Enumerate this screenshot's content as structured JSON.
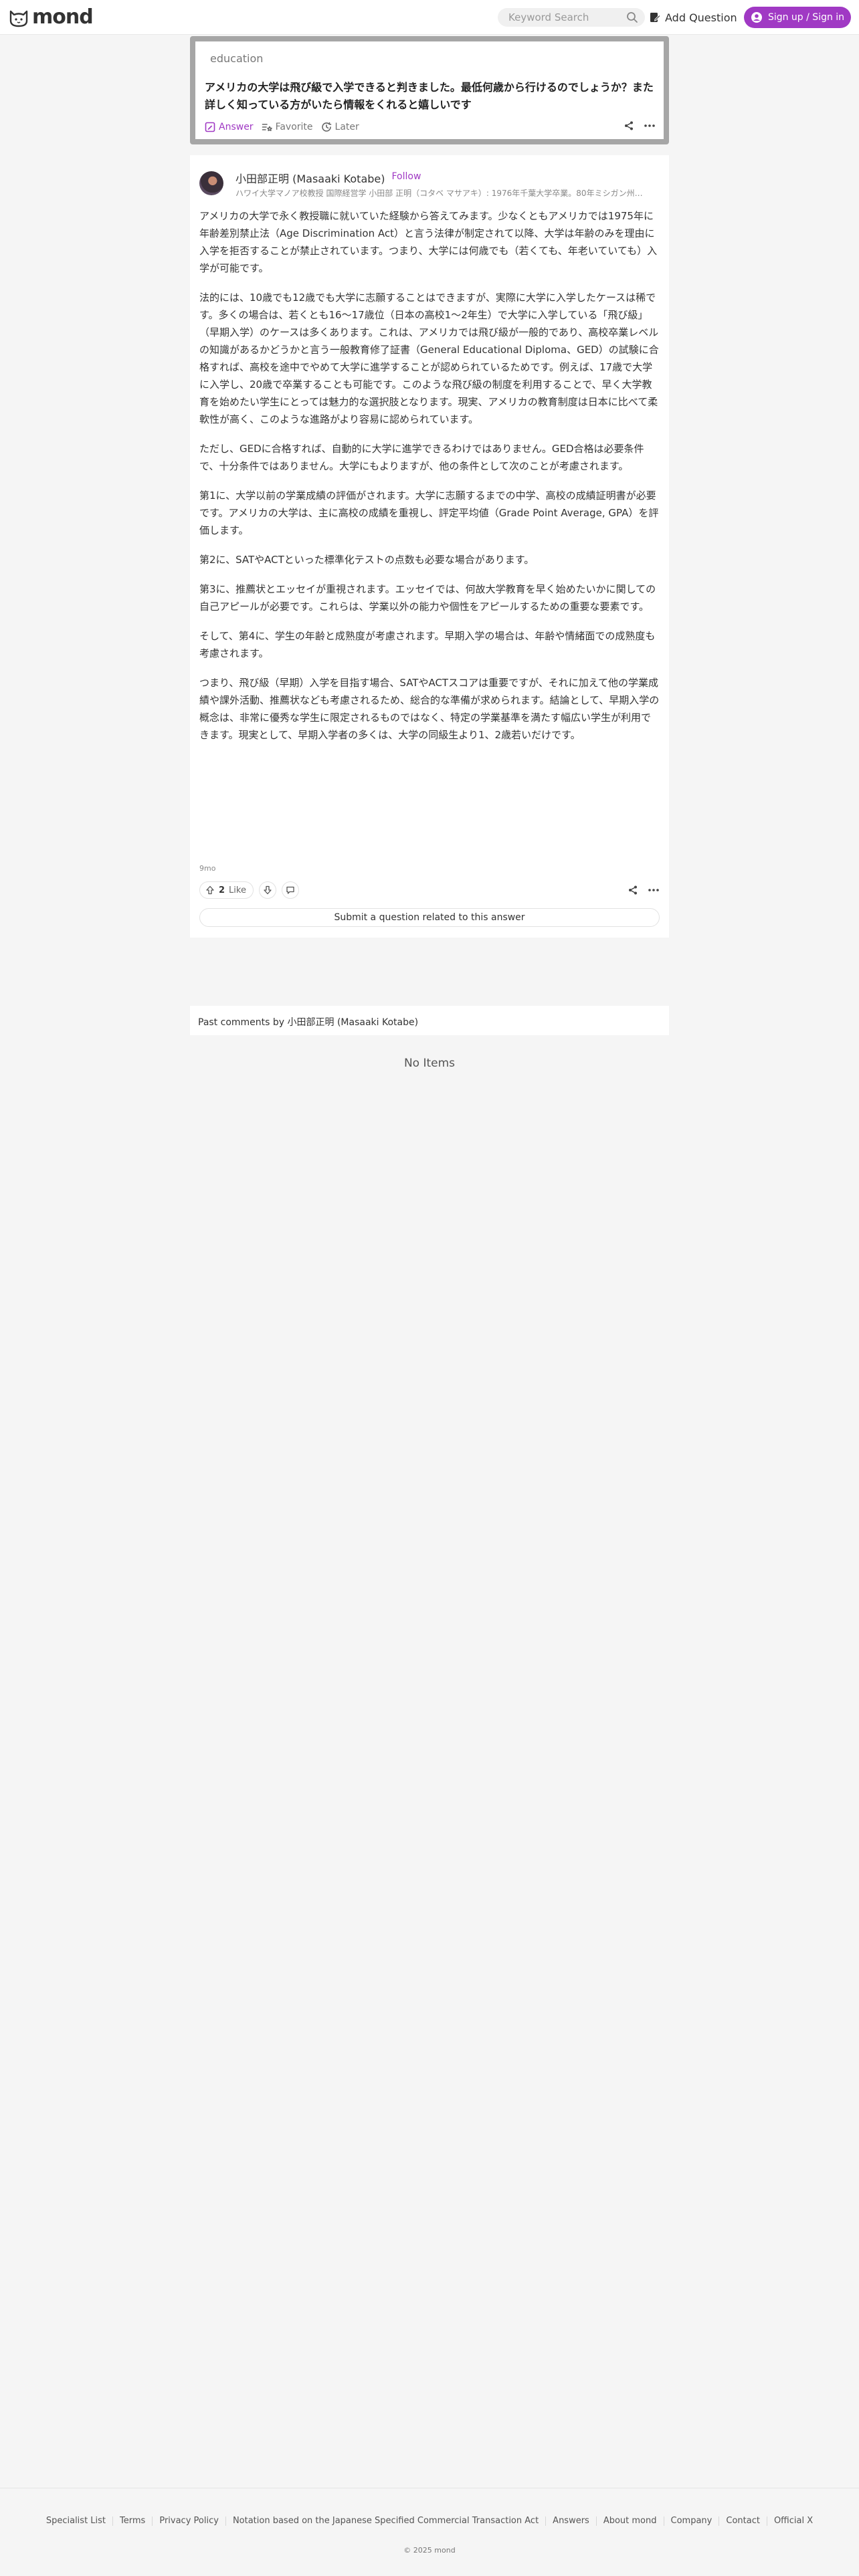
{
  "header": {
    "logo_text": "mond",
    "search_placeholder": "Keyword Search",
    "add_question_label": "Add Question",
    "signin_label": "Sign up / Sign in"
  },
  "question": {
    "category": "education",
    "title": "アメリカの大学は飛び級で入学できると判きました。最低何歳から行けるのでしょうか？また詳しく知っている方がいたら情報をくれると嬉しいです",
    "actions": {
      "answer": "Answer",
      "favorite": "Favorite",
      "later": "Later"
    }
  },
  "answer": {
    "author_name": "小田部正明 (Masaaki Kotabe)",
    "follow_label": "Follow",
    "author_bio": "ハワイ大学マノア校教授 国際経営学 小田部 正明（コタベ マサアキ）: 1976年千葉大学卒業。80年ミシガン州立大...",
    "paragraphs": [
      "アメリカの大学で永く教授職に就いていた経験から答えてみます。少なくともアメリカでは1975年に年齢差別禁止法（Age Discrimination Act）と言う法律が制定されて以降、大学は年齢のみを理由に入学を拒否することが禁止されています。つまり、大学には何歳でも（若くても、年老いていても）入学が可能です。",
      "法的には、10歳でも12歳でも大学に志願することはできますが、実際に大学に入学したケースは稀です。多くの場合は、若くとも16〜17歳位（日本の高校1〜2年生）で大学に入学している「飛び級」（早期入学）のケースは多くあります。これは、アメリカでは飛び級が一般的であり、高校卒業レベルの知識があるかどうかと言う一般教育修了証書（General Educational Diploma、GED）の試験に合格すれば、高校を途中でやめて大学に進学することが認められているためです。例えば、17歳で大学に入学し、20歳で卒業することも可能です。このような飛び級の制度を利用することで、早く大学教育を始めたい学生にとっては魅力的な選択肢となります。現実、アメリカの教育制度は日本に比べて柔軟性が高く、このような進路がより容易に認められています。",
      "ただし、GEDに合格すれば、自動的に大学に進学できるわけではありません。GED合格は必要条件で、十分条件ではありません。大学にもよりますが、他の条件として次のことが考慮されます。",
      "第1に、大学以前の学業成績の評価がされます。大学に志願するまでの中学、高校の成績証明書が必要です。アメリカの大学は、主に高校の成績を重視し、評定平均値（Grade Point Average, GPA）を評価します。",
      "第2に、SATやACTといった標準化テストの点数も必要な場合があります。",
      "第3に、推薦状とエッセイが重視されます。エッセイでは、何故大学教育を早く始めたいかに関しての自己アピールが必要です。これらは、学業以外の能力や個性をアピールするための重要な要素です。",
      "そして、第4に、学生の年齢と成熟度が考慮されます。早期入学の場合は、年齢や情緒面での成熟度も考慮されます。",
      "つまり、飛び級（早期）入学を目指す場合、SATやACTスコアは重要ですが、それに加えて他の学業成績や課外活動、推薦状なども考慮されるため、総合的な準備が求められます。結論として、早期入学の概念は、非常に優秀な学生に限定されるものではなく、特定の学業基準を満たす幅広い学生が利用できます。現実として、早期入学者の多くは、大学の同級生より1、2歳若いだけです。"
    ],
    "time_ago": "9mo",
    "like_count": "2",
    "like_label": "Like",
    "submit_question_label": "Submit a question related to this answer"
  },
  "past_comments": {
    "title": "Past comments by 小田部正明 (Masaaki Kotabe)",
    "empty_text": "No Items"
  },
  "footer": {
    "links": [
      "Specialist List",
      "Terms",
      "Privacy Policy",
      "Notation based on the Japanese Specified Commercial Transaction Act",
      "Answers",
      "About mond",
      "Company",
      "Contact",
      "Official X"
    ],
    "copyright": "© 2025 mond"
  },
  "colors": {
    "accent": "#a039c4",
    "page_bg": "#f5f5f5",
    "card_border": "#a6a6a6"
  }
}
